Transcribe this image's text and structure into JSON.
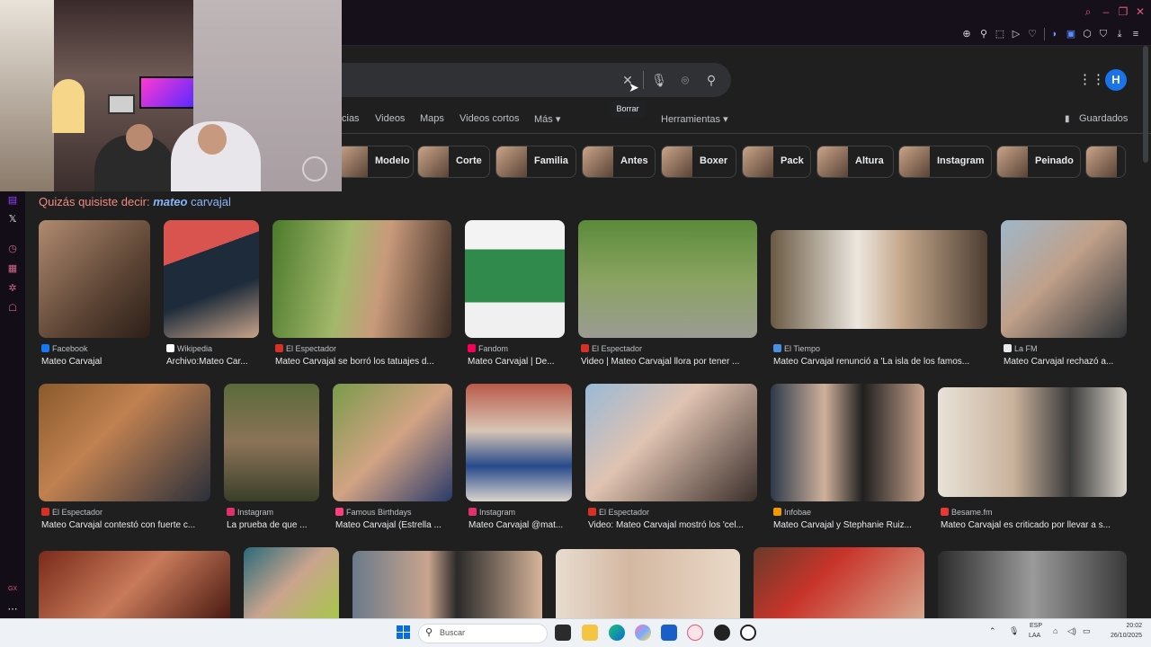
{
  "browser": {
    "toolbar_icons": [
      "zoom-icon",
      "pin-icon",
      "screenshot-icon",
      "play-icon",
      "heart-icon",
      "translate-icon",
      "chat-icon",
      "extensions-icon",
      "wallet-icon",
      "download-icon",
      "menu-icon"
    ]
  },
  "search": {
    "query": "",
    "clear_tooltip": "Borrar"
  },
  "account": {
    "avatar_letter": "H"
  },
  "tabs": [
    {
      "label": "cias"
    },
    {
      "label": "Videos"
    },
    {
      "label": "Maps"
    },
    {
      "label": "Videos cortos"
    },
    {
      "label": "Más"
    },
    {
      "label": "Herramientas"
    }
  ],
  "saved_label": "Guardados",
  "chips": [
    {
      "label": "Modelo"
    },
    {
      "label": "Corte"
    },
    {
      "label": "Familia"
    },
    {
      "label": "Antes"
    },
    {
      "label": "Boxer"
    },
    {
      "label": "Pack"
    },
    {
      "label": "Altura"
    },
    {
      "label": "Instagram"
    },
    {
      "label": "Peinado"
    }
  ],
  "did_you_mean": {
    "prefix": "Quizás quisiste decir:",
    "emphasis": "mateo",
    "rest": "carvajal"
  },
  "results": [
    {
      "source": "Facebook",
      "title": "Mateo Carvajal",
      "color": "#1877f2"
    },
    {
      "source": "Wikipedia",
      "title": "Archivo:Mateo Car...",
      "color": "#ffffff"
    },
    {
      "source": "El Espectador",
      "title": "Mateo Carvajal se borró los tatuajes d...",
      "color": "#d93025"
    },
    {
      "source": "Fandom",
      "title": "Mateo Carvajal | De...",
      "color": "#fa005a"
    },
    {
      "source": "El Espectador",
      "title": "Video | Mateo Carvajal llora por tener ...",
      "color": "#d93025"
    },
    {
      "source": "El Tiempo",
      "title": "Mateo Carvajal renunció a 'La isla de los famos...",
      "color": "#4a90e2"
    },
    {
      "source": "La FM",
      "title": "Mateo Carvajal rechazó a...",
      "color": "#e8eaed"
    },
    {
      "source": "El Espectador",
      "title": "Mateo Carvajal contestó con fuerte c...",
      "color": "#d93025"
    },
    {
      "source": "Instagram",
      "title": "La prueba de que ...",
      "color": "#e1306c"
    },
    {
      "source": "Famous Birthdays",
      "title": "Mateo Carvajal (Estrella ...",
      "color": "#ff3e7f"
    },
    {
      "source": "Instagram",
      "title": "Mateo Carvajal @mat...",
      "color": "#e1306c"
    },
    {
      "source": "El Espectador",
      "title": "Video: Mateo Carvajal mostró los 'cel...",
      "color": "#d93025"
    },
    {
      "source": "Infobae",
      "title": "Mateo Carvajal y Stephanie Ruiz...",
      "color": "#f29900"
    },
    {
      "source": "Besame.fm",
      "title": "Mateo Carvajal es criticado por llevar a s...",
      "color": "#e53935"
    }
  ],
  "sidebar_icons": [
    "twitch-icon",
    "x-icon",
    "clock-icon",
    "news-icon",
    "bug-icon",
    "robot-icon",
    "gx-icon",
    "more-icon"
  ],
  "sidebar_gx_label": "GX",
  "taskbar": {
    "search_label": "Buscar",
    "lang_top": "ESP",
    "lang_bottom": "LAA",
    "time": "20:02",
    "date": "26/10/2025"
  }
}
